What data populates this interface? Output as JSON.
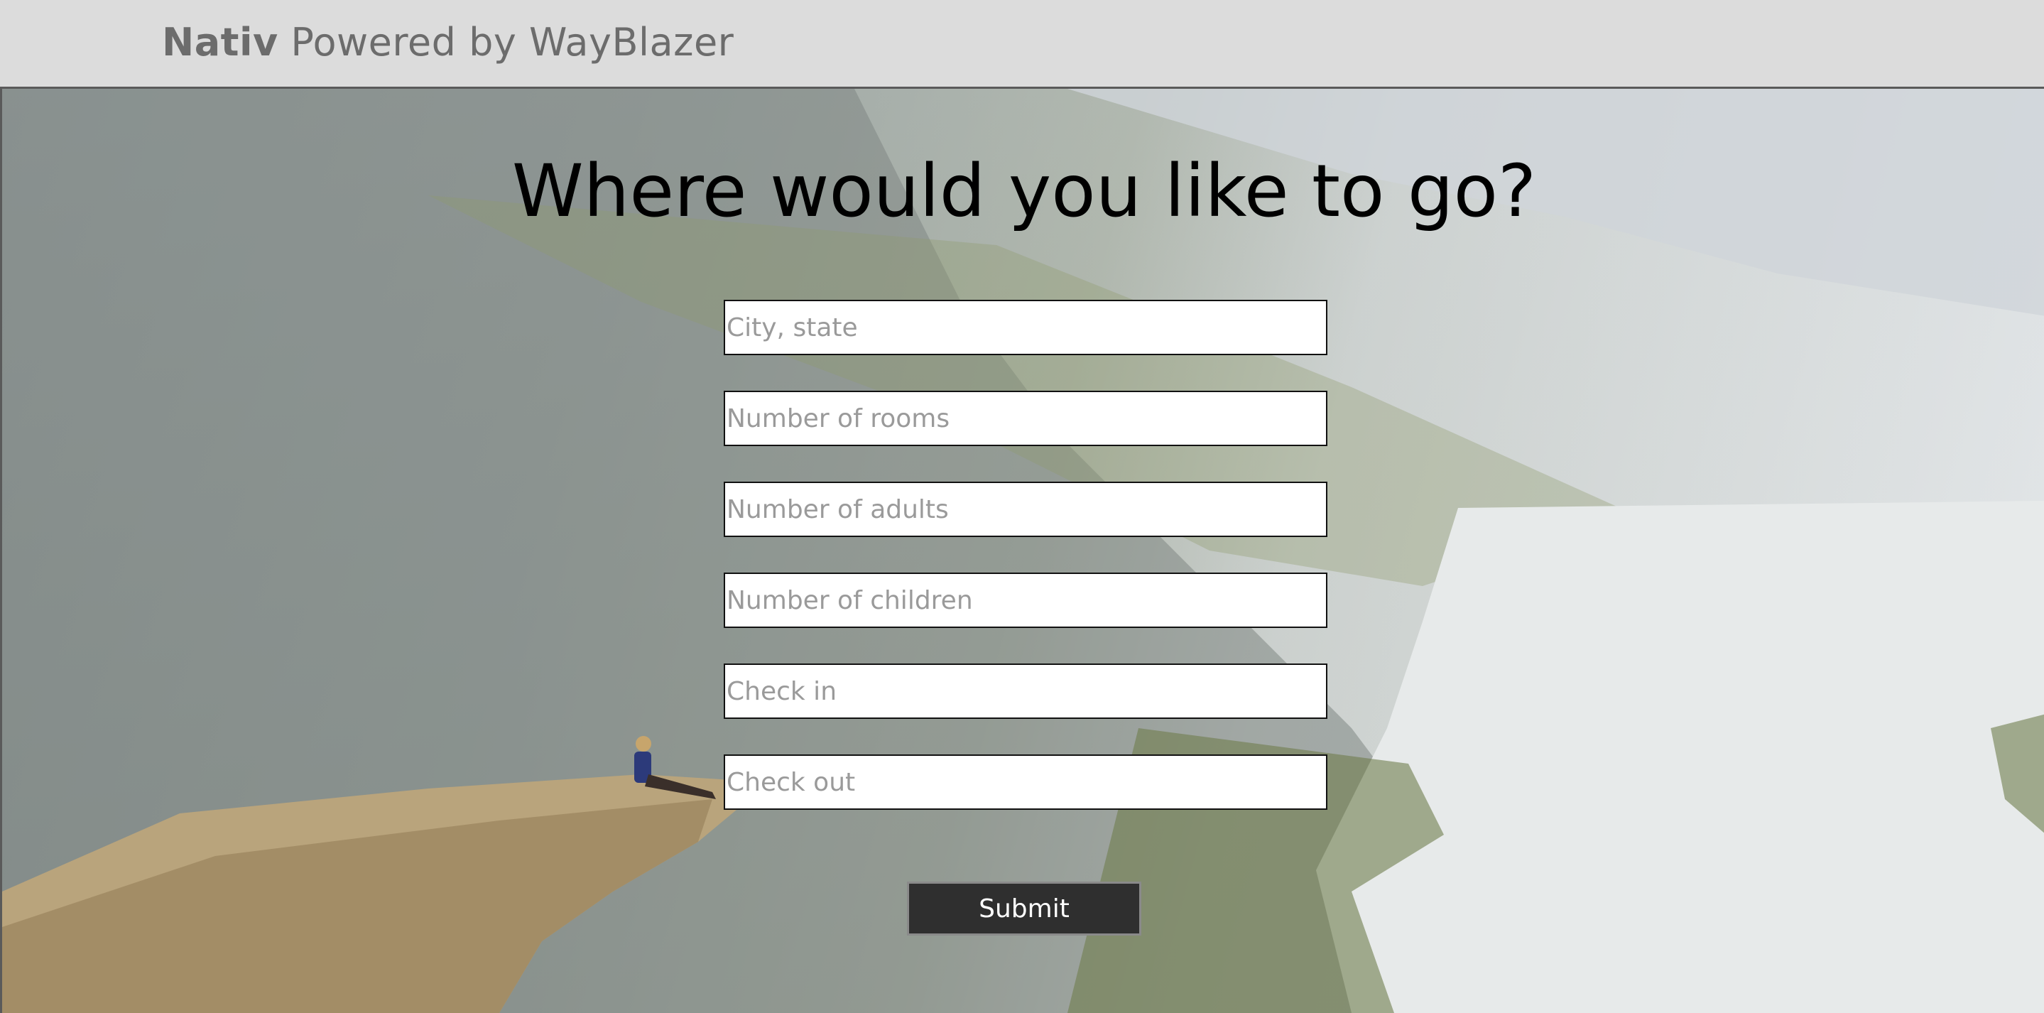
{
  "header": {
    "brand_name": "Nativ",
    "brand_tagline": "Powered by WayBlazer"
  },
  "main": {
    "heading": "Where would you like to go?"
  },
  "form": {
    "city_placeholder": "City, state",
    "rooms_placeholder": "Number of rooms",
    "adults_placeholder": "Number of adults",
    "children_placeholder": "Number of children",
    "checkin_placeholder": "Check in",
    "checkout_placeholder": "Check out",
    "submit_label": "Submit"
  }
}
